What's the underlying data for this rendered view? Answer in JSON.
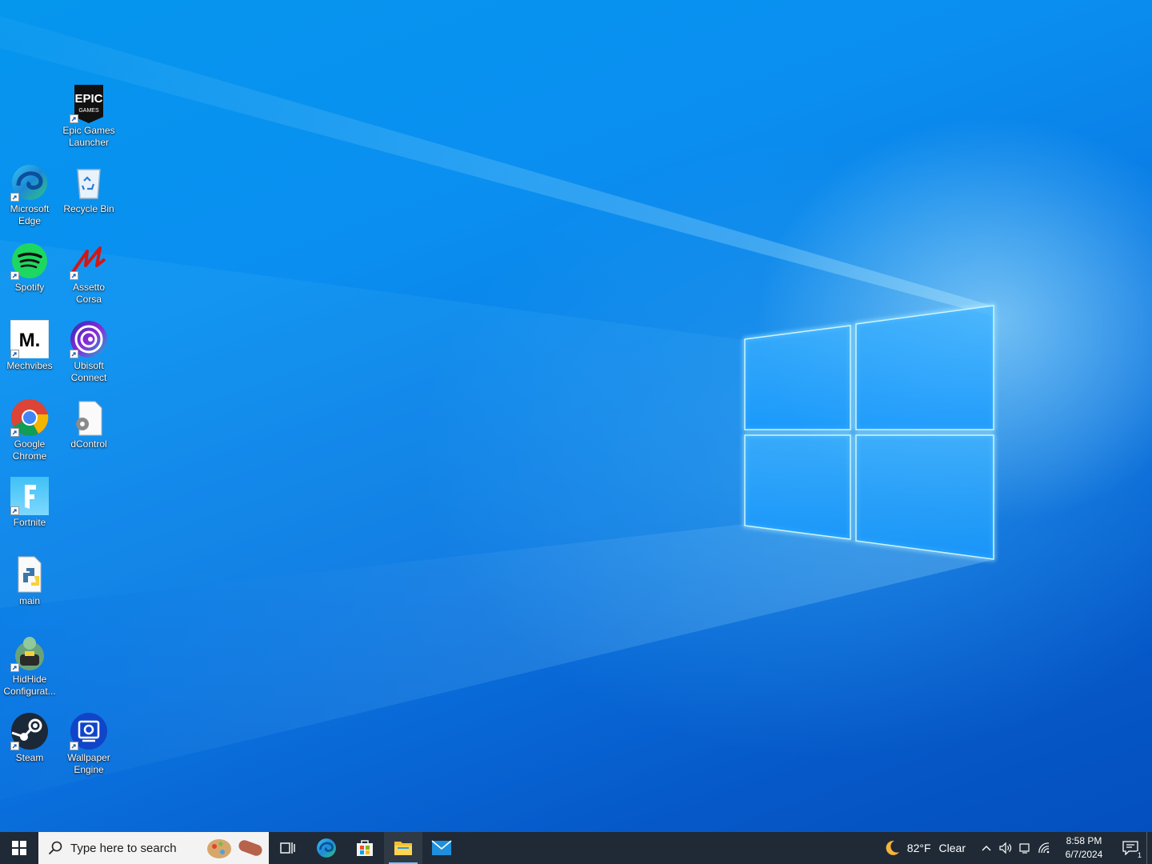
{
  "desktop": {
    "icons": [
      {
        "label": "Epic Games Launcher",
        "icon": "epic-games-icon"
      },
      {
        "label": "Microsoft Edge",
        "icon": "edge-icon"
      },
      {
        "label": "Recycle Bin",
        "icon": "recycle-bin-icon"
      },
      {
        "label": "Spotify",
        "icon": "spotify-icon"
      },
      {
        "label": "Assetto Corsa",
        "icon": "assetto-corsa-icon"
      },
      {
        "label": "Mechvibes",
        "icon": "mechvibes-icon"
      },
      {
        "label": "Ubisoft Connect",
        "icon": "ubisoft-icon"
      },
      {
        "label": "Google Chrome",
        "icon": "chrome-icon"
      },
      {
        "label": "dControl",
        "icon": "dcontrol-icon"
      },
      {
        "label": "Fortnite",
        "icon": "fortnite-icon"
      },
      {
        "label": "main",
        "icon": "python-file-icon"
      },
      {
        "label": "HidHide Configurat...",
        "icon": "hidhide-icon"
      },
      {
        "label": "Steam",
        "icon": "steam-icon"
      },
      {
        "label": "Wallpaper Engine",
        "icon": "wallpaper-engine-icon"
      }
    ],
    "epic_logo_text": "EPIC",
    "epic_logo_sub": "GAMES",
    "mechvibes_logo_text": "M."
  },
  "taskbar": {
    "search_placeholder": "Type here to search",
    "pinned": [
      "task-view-icon",
      "edge-icon",
      "store-icon",
      "file-explorer-icon",
      "mail-icon"
    ],
    "weather": {
      "temp": "82°F",
      "condition": "Clear",
      "icon": "moon-icon"
    },
    "clock": {
      "time": "8:58 PM",
      "date": "6/7/2024"
    },
    "notification_count": "1"
  },
  "colors": {
    "taskbar_bg": "#1f2a36",
    "desktop_blue": "#0a78e3",
    "active_indicator": "#7ec3ff"
  }
}
